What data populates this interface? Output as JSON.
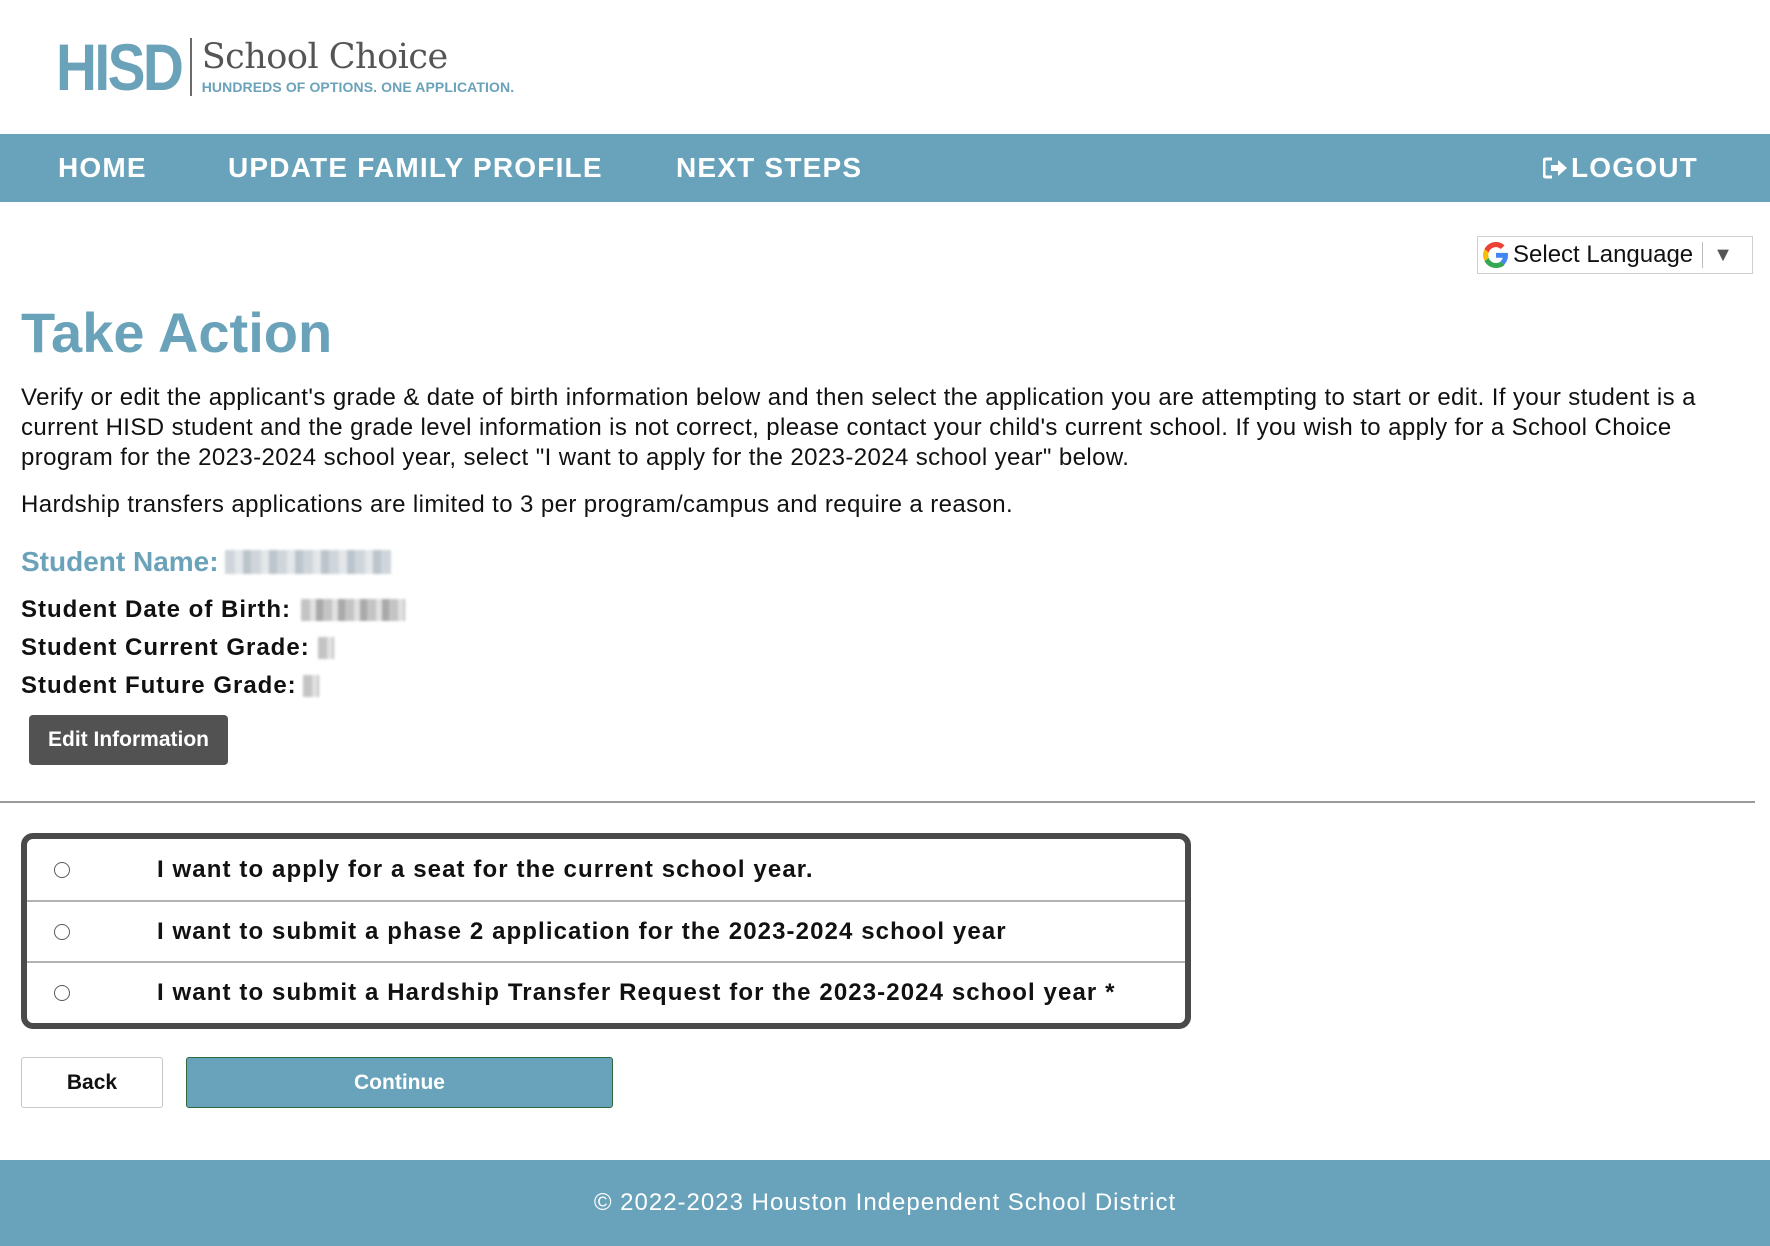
{
  "logo": {
    "mark": "HISD",
    "title": "School Choice",
    "tagline": "HUNDREDS OF OPTIONS. ONE APPLICATION."
  },
  "nav": {
    "home": "HOME",
    "update_profile": "UPDATE FAMILY PROFILE",
    "next_steps": "NEXT STEPS",
    "logout": "LOGOUT"
  },
  "language": {
    "label": "Select Language",
    "arrow": "▼"
  },
  "page": {
    "title": "Take Action",
    "intro": "Verify or edit the applicant's grade & date of birth information below and then select the application you are attempting to start or edit. If your student is a current HISD student and the grade level information is not correct, please contact your child's current school. If you wish to apply for a School Choice program for the 2023-2024 school year, select \"I want to apply for the 2023-2024 school year\" below.",
    "hardship_note": "Hardship transfers applications are limited to 3 per program/campus and require a reason."
  },
  "student": {
    "name_label": "Student Name:",
    "dob_label": "Student Date of Birth:",
    "current_grade_label": "Student Current Grade:",
    "future_grade_label": "Student Future Grade:",
    "edit_button": "Edit Information"
  },
  "options": [
    {
      "label": "I want to apply for a seat for the current school year.",
      "selected": false
    },
    {
      "label": "I want to submit a phase 2 application for the 2023-2024 school year",
      "selected": false
    },
    {
      "label": "I want to submit a Hardship Transfer Request for the 2023-2024 school year *",
      "selected": false
    }
  ],
  "actions": {
    "back": "Back",
    "continue": "Continue"
  },
  "footer": {
    "text": "© 2022-2023 Houston Independent School District"
  },
  "colors": {
    "brand": "#68a3bb",
    "heading": "#6aa2ba",
    "edit_button": "#525252"
  },
  "icons": {
    "logout": "logout-icon",
    "google": "google-icon"
  }
}
